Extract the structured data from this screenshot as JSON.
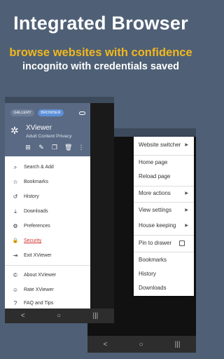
{
  "promo": {
    "headline": "Integrated Browser",
    "subtitle_1": "browse websites with confidence",
    "subtitle_2": "incognito with credentials saved"
  },
  "colors": {
    "background": "#4f6076",
    "accent_yellow": "#f2b71c",
    "drawer_header": "#5a6a84",
    "active_tab": "#5d8fd8",
    "security_red": "#d32f2f"
  },
  "drawer": {
    "tabs": [
      "GALLERY",
      "BROWSER"
    ],
    "app_name": "XViewer",
    "app_subtitle": "Adult Content Privacy",
    "header_icons": [
      "add-icon",
      "edit-icon",
      "copy-icon",
      "trash-icon",
      "more-vert-icon"
    ],
    "items": [
      {
        "label": "Search & Add",
        "icon": "search-icon",
        "glyph": "⌕"
      },
      {
        "label": "Bookmarks",
        "icon": "star-icon",
        "glyph": "☆"
      },
      {
        "label": "History",
        "icon": "history-icon",
        "glyph": "↺"
      },
      {
        "label": "Downloads",
        "icon": "download-icon",
        "glyph": "⤓"
      },
      {
        "label": "Preferences",
        "icon": "gear-icon",
        "glyph": "⚙"
      },
      {
        "label": "Security",
        "icon": "lock-icon",
        "glyph": "🔒"
      },
      {
        "label": "Exit XViewer",
        "icon": "exit-icon",
        "glyph": "⇥"
      },
      {
        "label": "About XViewer",
        "icon": "copyright-icon",
        "glyph": "©"
      },
      {
        "label": "Rate XViewer",
        "icon": "smile-icon",
        "glyph": "☺"
      },
      {
        "label": "FAQ and Tips",
        "icon": "help-icon",
        "glyph": "?"
      }
    ]
  },
  "menu": {
    "items": [
      {
        "label": "Website switcher",
        "submenu": true
      },
      {
        "label": "Home page"
      },
      {
        "label": "Reload page"
      },
      {
        "label": "More actions",
        "submenu": true
      },
      {
        "label": "View settings",
        "submenu": true
      },
      {
        "label": "House keeping",
        "submenu": true
      },
      {
        "label": "Pin to drawer",
        "checkbox": true,
        "checked": false
      },
      {
        "label": "Bookmarks"
      },
      {
        "label": "History"
      },
      {
        "label": "Downloads"
      }
    ]
  },
  "navbar": {
    "back": "<",
    "home": "○",
    "recents": "|||"
  }
}
